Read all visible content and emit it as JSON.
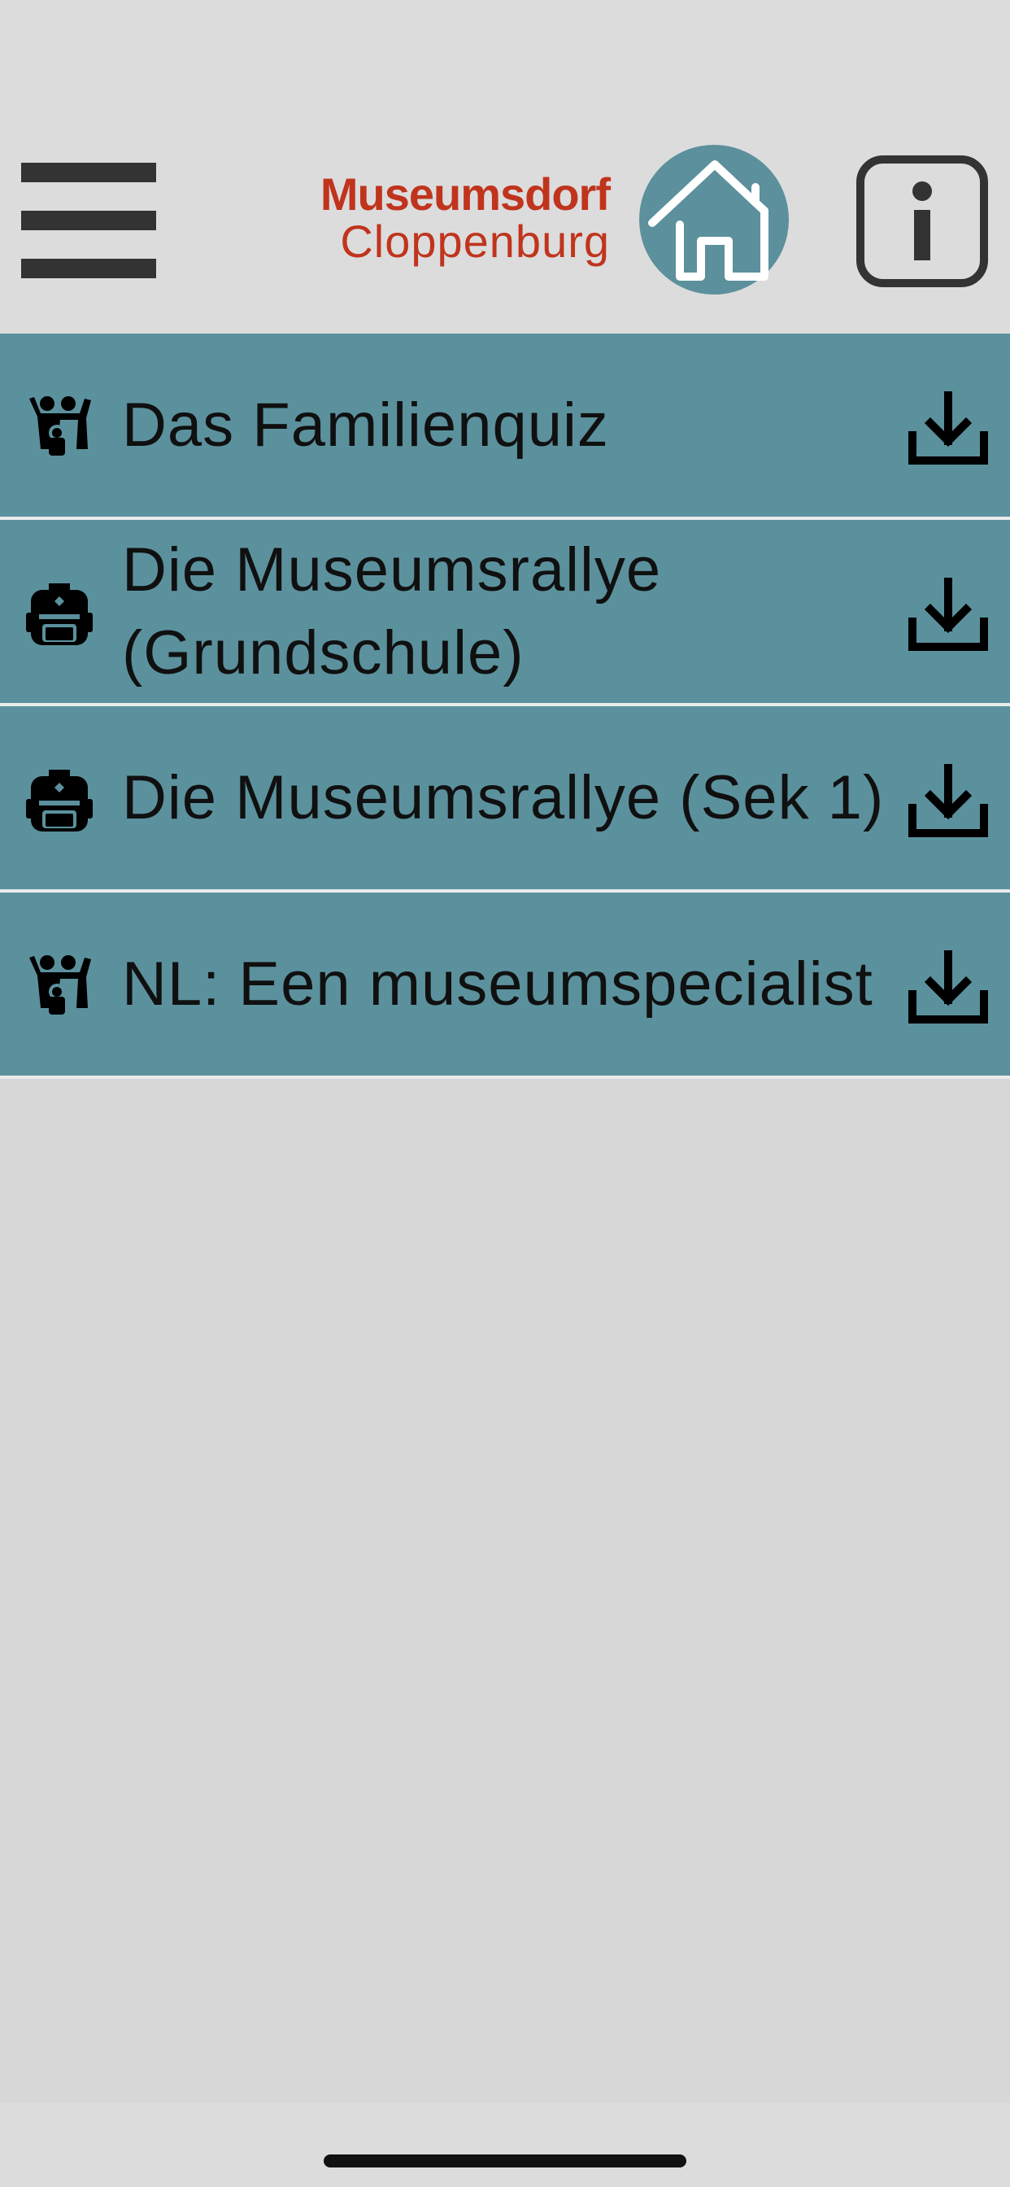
{
  "header": {
    "logo_line1": "Museumsdorf",
    "logo_line2": "Cloppenburg",
    "brand_color": "#c0341d",
    "accent_color": "#5b919d",
    "menu_icon": "hamburger-menu-icon",
    "home_icon": "home-icon",
    "info_icon": "info-icon"
  },
  "tours": [
    {
      "title": "Das Familienquiz",
      "icon": "family-icon",
      "action_icon": "download-icon"
    },
    {
      "title": "Die Museumsrallye (Grundschule)",
      "icon": "backpack-icon",
      "action_icon": "download-icon"
    },
    {
      "title": "Die Museumsrallye (Sek 1)",
      "icon": "backpack-icon",
      "action_icon": "download-icon"
    },
    {
      "title": "NL: Een museumspecialist",
      "icon": "family-icon",
      "action_icon": "download-icon"
    }
  ]
}
